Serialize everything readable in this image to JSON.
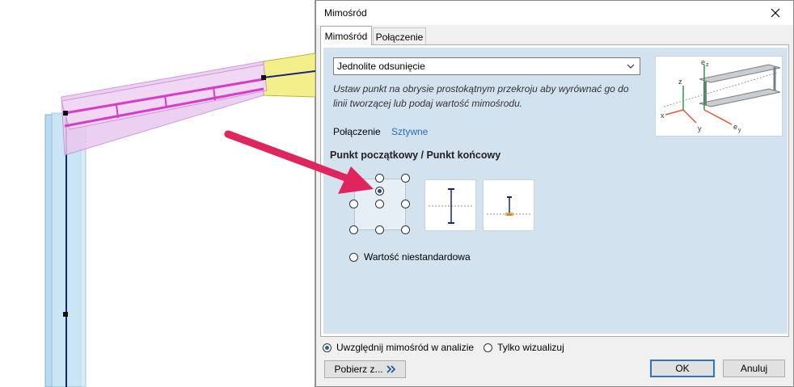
{
  "dialog": {
    "title": "Mimośród",
    "close_icon": "close-icon"
  },
  "tabs": [
    {
      "label": "Mimośród",
      "active": true
    },
    {
      "label": "Połączenie",
      "active": false
    }
  ],
  "offset_type": {
    "selected": "Jednolite odsunięcie"
  },
  "hint": "Ustaw punkt na obrysie prostokątnym przekroju aby wyrównać go do linii tworzącej lub podaj wartość mimośrodu.",
  "connection": {
    "label": "Połączenie",
    "value": "Sztywne"
  },
  "illustration": {
    "axis_labels": [
      "x",
      "y",
      "z",
      "e",
      "z",
      "e",
      "y"
    ]
  },
  "section": {
    "title": "Punkt początkowy / Punkt końcowy"
  },
  "reference_point": {
    "selected": "top-center"
  },
  "custom_value_label": "Wartość niestandardowa",
  "options": {
    "include_label": "Uwzględnij mimośród w analizie",
    "include_selected": true,
    "visualize_label": "Tylko wizualizuj",
    "visualize_selected": false
  },
  "buttons": {
    "get_from": "Pobierz z...",
    "ok": "OK",
    "cancel": "Anuluj"
  },
  "colors": {
    "panel": "#d2e2ef",
    "link": "#2a6ebb",
    "member_highlight": "#d63bc9",
    "arrow": "#e0245e"
  }
}
